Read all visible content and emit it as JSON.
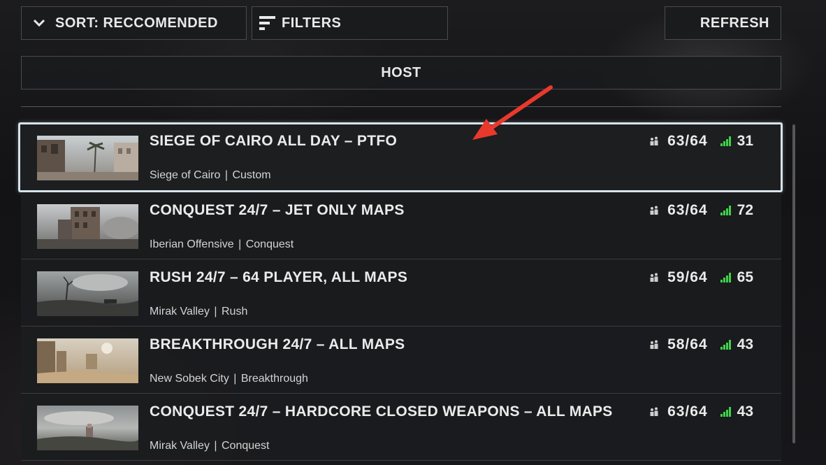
{
  "toolbar": {
    "sort_label": "SORT: RECCOMENDED",
    "filters_label": "FILTERS",
    "refresh_label": "REFRESH",
    "host_label": "HOST"
  },
  "servers": [
    {
      "title": "SIEGE OF CAIRO ALL DAY – PTFO",
      "map": "Siege of Cairo",
      "mode": "Custom",
      "players": "63/64",
      "ping": "31",
      "selected": true,
      "thumb": "desert-city"
    },
    {
      "title": "CONQUEST 24/7 – JET ONLY MAPS",
      "map": "Iberian Offensive",
      "mode": "Conquest",
      "players": "63/64",
      "ping": "72",
      "selected": false,
      "thumb": "ruined-buildings"
    },
    {
      "title": "RUSH 24/7 – 64  PLAYER, ALL MAPS",
      "map": "Mirak Valley",
      "mode": "Rush",
      "players": "59/64",
      "ping": "65",
      "selected": false,
      "thumb": "stormy-valley"
    },
    {
      "title": "BREAKTHROUGH 24/7 – ALL MAPS",
      "map": "New Sobek City",
      "mode": "Breakthrough",
      "players": "58/64",
      "ping": "43",
      "selected": false,
      "thumb": "sandy-ruins"
    },
    {
      "title": "CONQUEST 24/7 – HARDCORE CLOSED WEAPONS – ALL MAPS",
      "map": "Mirak Valley",
      "mode": "Conquest",
      "players": "63/64",
      "ping": "43",
      "selected": false,
      "thumb": "cloudy-valley"
    }
  ],
  "colors": {
    "signal": "#3fd24a",
    "selected_border": "#d7e3ea",
    "arrow": "#e8392c"
  },
  "icons": {
    "sort": "chevron-down-icon",
    "filters": "filter-lines-icon",
    "players": "players-icon",
    "ping": "signal-bars-icon",
    "annotation": "red-arrow-icon"
  }
}
